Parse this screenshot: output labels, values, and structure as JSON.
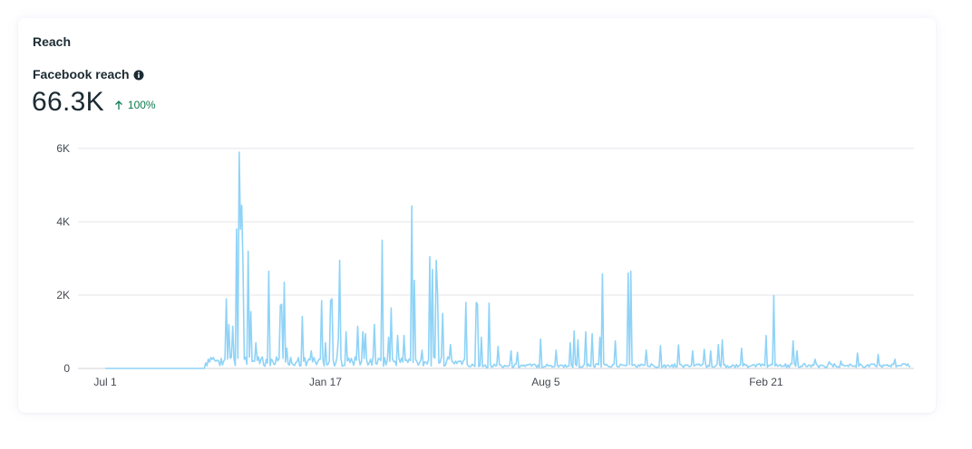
{
  "card": {
    "title": "Reach",
    "metric_label": "Facebook reach",
    "info_icon": "info-icon",
    "metric_value": "66.3K",
    "change_icon": "arrow-up-icon",
    "change_text": "100%"
  },
  "colors": {
    "text": "#1c2b33",
    "positive": "#0b7a4e",
    "line": "#8fd3f7",
    "grid": "#e4e6eb",
    "axis_text": "#444950"
  },
  "chart_data": {
    "type": "line",
    "title": "",
    "xlabel": "",
    "ylabel": "",
    "ylim": [
      0,
      6000
    ],
    "yticks": [
      0,
      2000,
      4000,
      6000
    ],
    "ytick_labels": [
      "0",
      "2K",
      "4K",
      "6K"
    ],
    "xlim": [
      0,
      625
    ],
    "xticks": [
      0,
      171,
      342,
      513
    ],
    "xtick_labels": [
      "Jul 1",
      "Jan 17",
      "Aug 5",
      "Feb 21"
    ],
    "grid": true,
    "legend": "none",
    "series": [
      {
        "peaks": [
          [
            78,
            150
          ],
          [
            94,
            1900
          ],
          [
            96,
            1200
          ],
          [
            99,
            1150
          ],
          [
            102,
            3800
          ],
          [
            104,
            5900
          ],
          [
            105,
            3800
          ],
          [
            106,
            4450
          ],
          [
            107,
            2800
          ],
          [
            111,
            3200
          ],
          [
            113,
            1550
          ],
          [
            117,
            700
          ],
          [
            127,
            2650
          ],
          [
            136,
            1720
          ],
          [
            137,
            1750
          ],
          [
            139,
            2350
          ],
          [
            141,
            550
          ],
          [
            153,
            1420
          ],
          [
            160,
            480
          ],
          [
            168,
            1850
          ],
          [
            171,
            700
          ],
          [
            175,
            1850
          ],
          [
            176,
            1900
          ],
          [
            181,
            820
          ],
          [
            182,
            2950
          ],
          [
            187,
            1000
          ],
          [
            196,
            1150
          ],
          [
            200,
            1000
          ],
          [
            202,
            950
          ],
          [
            209,
            1200
          ],
          [
            215,
            3500
          ],
          [
            220,
            850
          ],
          [
            222,
            1650
          ],
          [
            227,
            900
          ],
          [
            232,
            900
          ],
          [
            238,
            4430
          ],
          [
            240,
            2400
          ],
          [
            246,
            500
          ],
          [
            252,
            3050
          ],
          [
            254,
            2700
          ],
          [
            257,
            2950
          ],
          [
            258,
            2000
          ],
          [
            262,
            1500
          ],
          [
            268,
            650
          ],
          [
            280,
            1800
          ],
          [
            288,
            1800
          ],
          [
            289,
            1750
          ],
          [
            292,
            850
          ],
          [
            298,
            1780
          ],
          [
            305,
            600
          ],
          [
            315,
            480
          ],
          [
            320,
            440
          ],
          [
            338,
            800
          ],
          [
            350,
            500
          ],
          [
            361,
            700
          ],
          [
            364,
            1020
          ],
          [
            367,
            780
          ],
          [
            373,
            1000
          ],
          [
            378,
            950
          ],
          [
            384,
            850
          ],
          [
            386,
            2580
          ],
          [
            396,
            750
          ],
          [
            406,
            2600
          ],
          [
            408,
            2650
          ],
          [
            420,
            500
          ],
          [
            431,
            620
          ],
          [
            445,
            640
          ],
          [
            456,
            480
          ],
          [
            465,
            520
          ],
          [
            470,
            480
          ],
          [
            476,
            650
          ],
          [
            479,
            780
          ],
          [
            494,
            550
          ],
          [
            513,
            900
          ],
          [
            519,
            1990
          ],
          [
            534,
            750
          ],
          [
            537,
            480
          ],
          [
            551,
            250
          ],
          [
            562,
            180
          ],
          [
            571,
            200
          ],
          [
            584,
            420
          ],
          [
            600,
            380
          ],
          [
            613,
            250
          ]
        ]
      }
    ]
  }
}
